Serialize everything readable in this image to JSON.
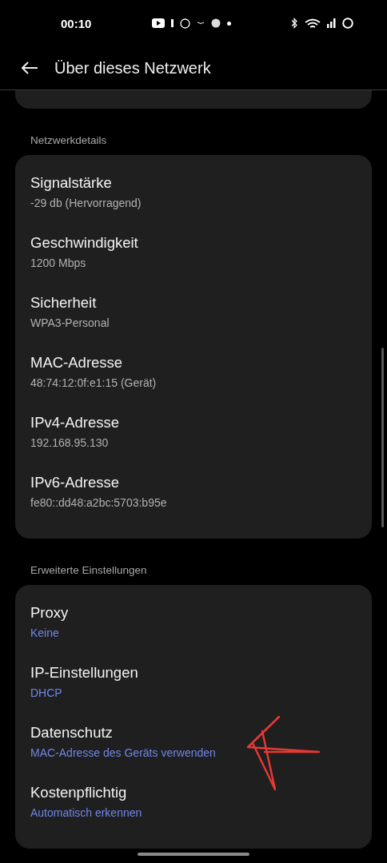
{
  "status_bar": {
    "time": "00:10"
  },
  "header": {
    "title": "Über dieses Netzwerk"
  },
  "sections": [
    {
      "heading": "Netzwerkdetails",
      "kind": "info",
      "items": [
        {
          "title": "Signalstärke",
          "value": "-29 db (Hervorragend)"
        },
        {
          "title": "Geschwindigkeit",
          "value": "1200 Mbps"
        },
        {
          "title": "Sicherheit",
          "value": "WPA3-Personal"
        },
        {
          "title": "MAC-Adresse",
          "value": "48:74:12:0f:e1:15 (Gerät)"
        },
        {
          "title": "IPv4-Adresse",
          "value": "192.168.95.130"
        },
        {
          "title": "IPv6-Adresse",
          "value": "fe80::dd48:a2bc:5703:b95e"
        }
      ]
    },
    {
      "heading": "Erweiterte Einstellungen",
      "kind": "setting",
      "items": [
        {
          "title": "Proxy",
          "value": "Keine"
        },
        {
          "title": "IP-Einstellungen",
          "value": "DHCP"
        },
        {
          "title": "Datenschutz",
          "value": "MAC-Adresse des Geräts verwenden"
        },
        {
          "title": "Kostenpflichtig",
          "value": "Automatisch erkennen"
        }
      ]
    }
  ]
}
